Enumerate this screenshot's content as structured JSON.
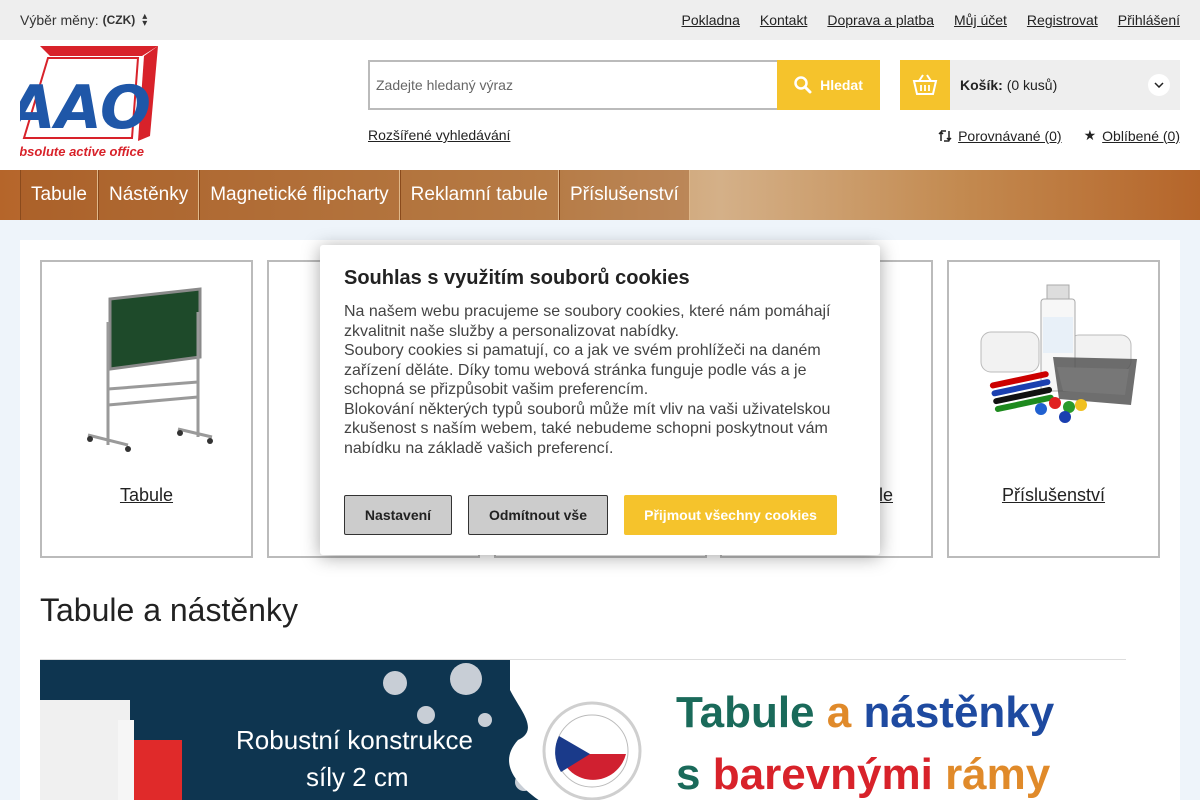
{
  "topbar": {
    "currency_label": "Výběr měny:",
    "currency_value": "(CZK)",
    "links": [
      "Pokladna",
      "Kontakt",
      "Doprava a platba",
      "Můj účet",
      "Registrovat",
      "Přihlášení"
    ]
  },
  "header": {
    "logo_text": "AAO",
    "logo_tagline": "absolute active office",
    "search_placeholder": "Zadejte hledaný výraz",
    "search_button": "Hledat",
    "advanced_search": "Rozšířené vyhledávání",
    "cart_label": "Košík:",
    "cart_count": "(0 kusů)",
    "compare_link": "Porovnávané (0)",
    "favorites_link": "Oblíbené (0)"
  },
  "nav": {
    "items": [
      "Tabule",
      "Nástěnky",
      "Magnetické flipcharty",
      "Reklamní tabule",
      "Příslušenství"
    ]
  },
  "categories": [
    {
      "label": "Tabule"
    },
    {
      "label": ""
    },
    {
      "label": ""
    },
    {
      "label": "le"
    },
    {
      "label": "Příslušenství"
    }
  ],
  "section_title": "Tabule a nástěnky",
  "banner": {
    "line1": "Robustní konstrukce",
    "line2": "síly 2 cm",
    "heading_part1": "Tabule",
    "heading_part2": "a",
    "heading_part3": "nástěnky",
    "heading2_part1": "s",
    "heading2_part2": "barevnými",
    "heading2_part3": "rámy"
  },
  "cookie": {
    "title": "Souhlas s využitím souborů cookies",
    "p1": "Na našem webu pracujeme se soubory cookies, které nám pomáhají zkvalitnit naše služby a personalizovat nabídky.",
    "p2": "Soubory cookies si pamatují, co a jak ve svém prohlížeči na daném zařízení děláte. Díky tomu webová stránka funguje podle vás a je schopná se přizpůsobit vašim preferencím.",
    "p3": "Blokování některých typů souborů může mít vliv na vaši uživatelskou zkušenost s naším webem, také nebudeme schopni poskytnout vám nabídku na základě vašich preferencí.",
    "btn_settings": "Nastavení",
    "btn_reject": "Odmítnout vše",
    "btn_accept": "Přijmout všechny cookies"
  },
  "colors": {
    "accent": "#f5c32c",
    "nav_brown": "#b5652a",
    "logo_blue": "#1f57a8",
    "logo_red": "#d8222a",
    "banner_navy": "#0e3550"
  }
}
